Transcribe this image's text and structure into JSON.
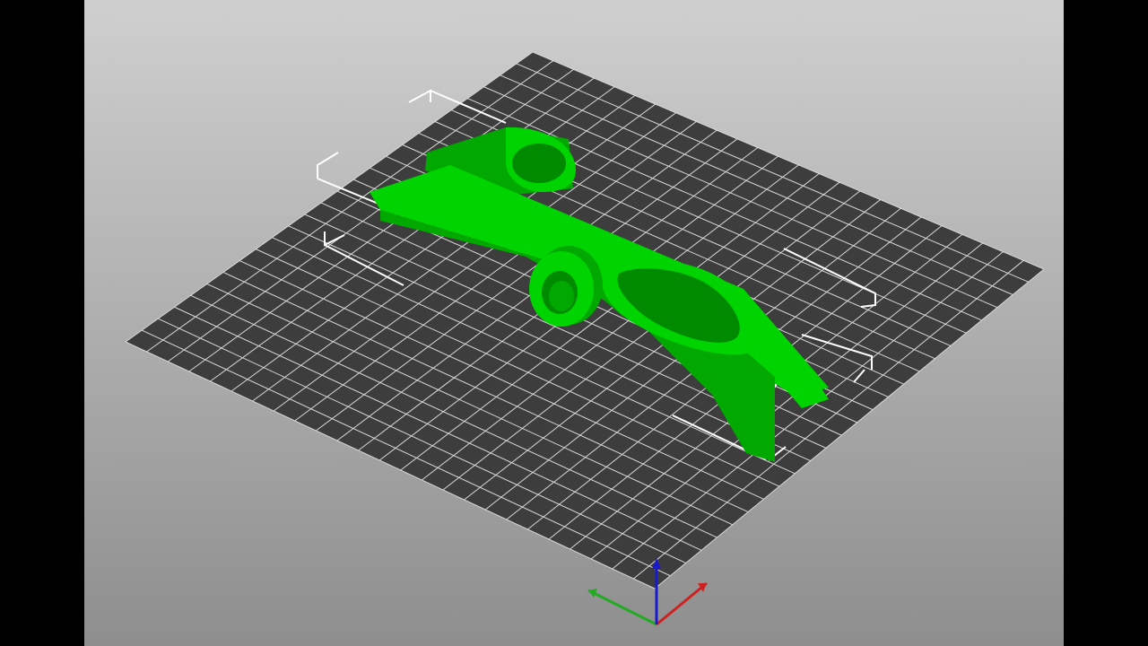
{
  "app": {
    "view": "3d-plater-viewport",
    "letterbox_color": "#000000"
  },
  "scene": {
    "background_top": "#cfcfcf",
    "background_bottom": "#8e8e8e",
    "bed_color": "#3d3d3d",
    "grid_color": "#d8d8d8",
    "model_color": "#00d400",
    "model_shade": "#00a800",
    "model_dark": "#008a00",
    "bounding_box_color": "#ffffff",
    "objects": [
      {
        "name": "green-part",
        "selected": true
      }
    ]
  },
  "axes": [
    {
      "name": "x-axis",
      "color": "#cc2222"
    },
    {
      "name": "y-axis",
      "color": "#22aa22"
    },
    {
      "name": "z-axis",
      "color": "#1a1acc"
    }
  ]
}
